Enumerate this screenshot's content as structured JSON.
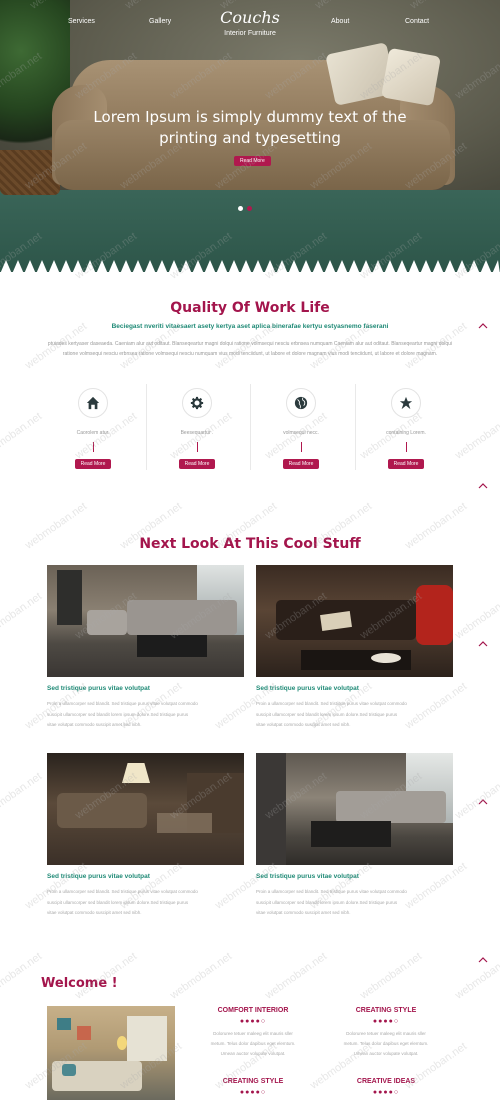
{
  "nav": {
    "items": [
      "Services",
      "Gallery",
      "About",
      "Contact"
    ],
    "logo": "Couchs",
    "logo_sub": "Interior Furniture"
  },
  "hero": {
    "title": "Lorem Ipsum is simply dummy text of the printing and typesetting",
    "button": "Read More",
    "slide_count": 2,
    "active_slide": 1
  },
  "quality": {
    "title": "Quality Of Work Life",
    "subtitle": "Beciegast nveriti vitaesaert asety kertya aset aplica binerafae kertyu estyasnemo faserani",
    "para1": "ptuiades kertyaser daseaeda. Caeniam alur aut oditaut. Blanseqeartur magni dolqui ratione volmsequi nesciu erbnsea numquam Caeniam alur aut oditaut.",
    "para2": "Blanseqeartur magni dolqui ratione volmsequi nesciu erbnsea ratione volmsequi nesciu numquam vius modi tenciidunt, ut labore et dolore magnam vius modi tenciidunt, ut labore et dolore magnam.",
    "features": [
      {
        "icon": "home-icon",
        "label": "Caorolem atur.",
        "button": "Read More"
      },
      {
        "icon": "gear-icon",
        "label": "Beesequartur .",
        "button": "Read More"
      },
      {
        "icon": "globe-icon",
        "label": "volmsequi necc.",
        "button": "Read More"
      },
      {
        "icon": "star-icon",
        "label": "containing Lorem.",
        "button": "Read More"
      }
    ]
  },
  "cool": {
    "title": "Next Look At This Cool Stuff",
    "cards": [
      {
        "title": "Sed tristique purus vitae volutpat",
        "line1": "Proin a ullamcorper sed blandit. Sed tristique purus vitae volutpat commodo",
        "line2": "suscipit ullamcorper sed blandit lorem ipsum dolore.Sed tristique purus",
        "line3": "vitae volutpat commodo suscipit amet sed nibh."
      },
      {
        "title": "Sed tristique purus vitae volutpat",
        "line1": "Proin a ullamcorper sed blandit. Sed tristique purus vitae volutpat commodo",
        "line2": "suscipit ullamcorper sed blandit lorem ipsum dolore.Sed tristique purus",
        "line3": "vitae volutpat commodo suscipit amet sed nibh."
      },
      {
        "title": "Sed tristique purus vitae volutpat",
        "line1": "Proin a ullamcorper sed blandit. Sed tristique purus vitae volutpat commodo",
        "line2": "suscipit ullamcorper sed blandit lorem ipsum dolore.Sed tristique purus",
        "line3": "vitae volutpat commodo suscipit amet sed nibh."
      },
      {
        "title": "Sed tristique purus vitae volutpat",
        "line1": "Proin a ullamcorper sed blandit. Sed tristique purus vitae volutpat commodo",
        "line2": "suscipit ullamcorper sed blandit lorem ipsum dolore.Sed tristique purus",
        "line3": "vitae volutpat commodo suscipit amet sed nibh."
      }
    ]
  },
  "welcome": {
    "title": "Welcome !",
    "cols": [
      {
        "heading": "COMFORT INTERIOR",
        "rating": 4,
        "line1": "Doloruree tetuer maleeg elit mauris sller",
        "line2": "metum. Telus dolor dapibus eget elemtum.",
        "line3": "Umean auctor volupate volutpat."
      },
      {
        "heading": "CREATING STYLE",
        "rating": 4,
        "line1": "Doloruree tetuer maleeg elit mauris sller",
        "line2": "metum. Telus dolor dapibus eget elemtum.",
        "line3": "Umean auctor volupate volutpat."
      },
      {
        "heading": "CREATING STYLE",
        "rating": 4
      },
      {
        "heading": "CREATIVE IDEAS",
        "rating": 4
      }
    ]
  },
  "watermark": "webmoban.net",
  "colors": {
    "accent": "#a3154c",
    "teal": "#1f8a76",
    "button": "#b0184e"
  }
}
